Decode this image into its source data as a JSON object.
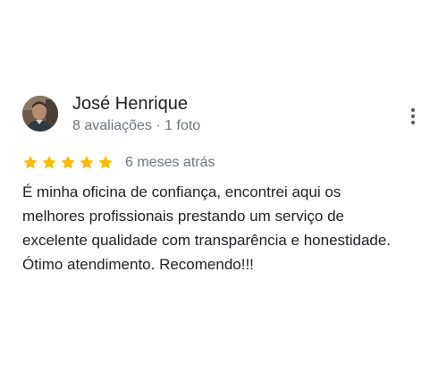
{
  "review": {
    "author": {
      "name": "José Henrique",
      "meta": "8 avaliações · 1 foto"
    },
    "rating": {
      "stars": 5,
      "max_stars": 5,
      "star_color": "#fbbc04"
    },
    "date": "6 meses atrás",
    "text": "É minha oficina de confiança,  encontrei aqui os\nmelhores profissionais prestando um serviço de\nexcelente qualidade com transparência e honestidade.\nÓtimo atendimento. Recomendo!!!"
  },
  "icons": {
    "more": "more-vert-icon",
    "star": "star-icon",
    "avatar": "profile-photo"
  },
  "colors": {
    "primary_text": "#202124",
    "secondary_text": "#70757a",
    "star": "#fbbc04"
  }
}
